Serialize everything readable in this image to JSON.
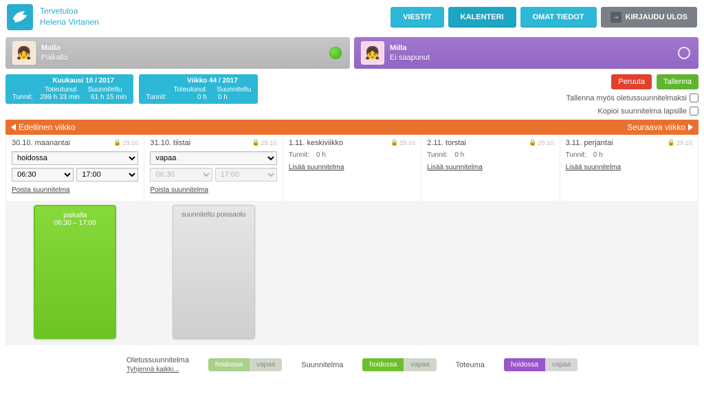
{
  "header": {
    "welcome_label": "Tervetuloa",
    "user_name": "Helena Virtanen",
    "nav": {
      "messages": "VIESTIT",
      "calendar": "KALENTERI",
      "mydata": "OMAT TIEDOT",
      "logout": "KIRJAUDU ULOS"
    }
  },
  "children": [
    {
      "name": "Malla",
      "status_text": "Paikalla"
    },
    {
      "name": "Milla",
      "status_text": "Ei saapunut"
    }
  ],
  "stats": {
    "month": {
      "title": "Kuukausi 10 / 2017",
      "col1_label": "Toteutunut",
      "col2_label": "Suunniteltu",
      "hours_label": "Tunnit:",
      "col1_val": "299 h 33 min",
      "col2_val": "61 h 15 min"
    },
    "week": {
      "title": "Viikko 44 / 2017",
      "col1_label": "Toteutunut",
      "col2_label": "Suunniteltu",
      "hours_label": "Tunnit:",
      "col1_val": "0 h",
      "col2_val": "0 h"
    }
  },
  "actions": {
    "cancel": "Peruuta",
    "save": "Tallenna",
    "save_default": "Tallenna myös oletussuunnitelmaksi",
    "copy_children": "Kopioi suunnitelma lapsille"
  },
  "weeknav": {
    "prev": "Edellinen viikko",
    "next": "Seuraava viikko"
  },
  "lock_date": "29.10.",
  "days": [
    {
      "title": "30.10. maanantai",
      "plan_type": "hoidossa",
      "t_start": "06:30",
      "t_end": "17:00",
      "remove": "Poista suunnitelma",
      "editable": true
    },
    {
      "title": "31.10. tiistai",
      "plan_type": "vapaa",
      "t_start": "06:30",
      "t_end": "17:00",
      "remove": "Poista suunnitelma",
      "editable": true,
      "times_disabled": true
    },
    {
      "title": "1.11. keskiviikko",
      "hours_label": "Tunnit:",
      "hours_val": "0 h",
      "add": "Lisää suunnitelma"
    },
    {
      "title": "2.11. torstai",
      "hours_label": "Tunnit:",
      "hours_val": "0 h",
      "add": "Lisää suunnitelma"
    },
    {
      "title": "3.11. perjantai",
      "hours_label": "Tunnit:",
      "hours_val": "0 h",
      "add": "Lisää suunnitelma"
    }
  ],
  "blocks": {
    "mon": {
      "label": "paikalla",
      "time": "06:30 – 17:00"
    },
    "tue": {
      "label": "suunniteltu poissaolo"
    }
  },
  "legend": {
    "default_label": "Oletussuunnitelma",
    "clear_all": "Tyhjennä kaikki...",
    "plan_label": "Suunnitelma",
    "actual_label": "Toteuma",
    "pill_in": "hoidossa",
    "pill_off": "vapaa"
  }
}
